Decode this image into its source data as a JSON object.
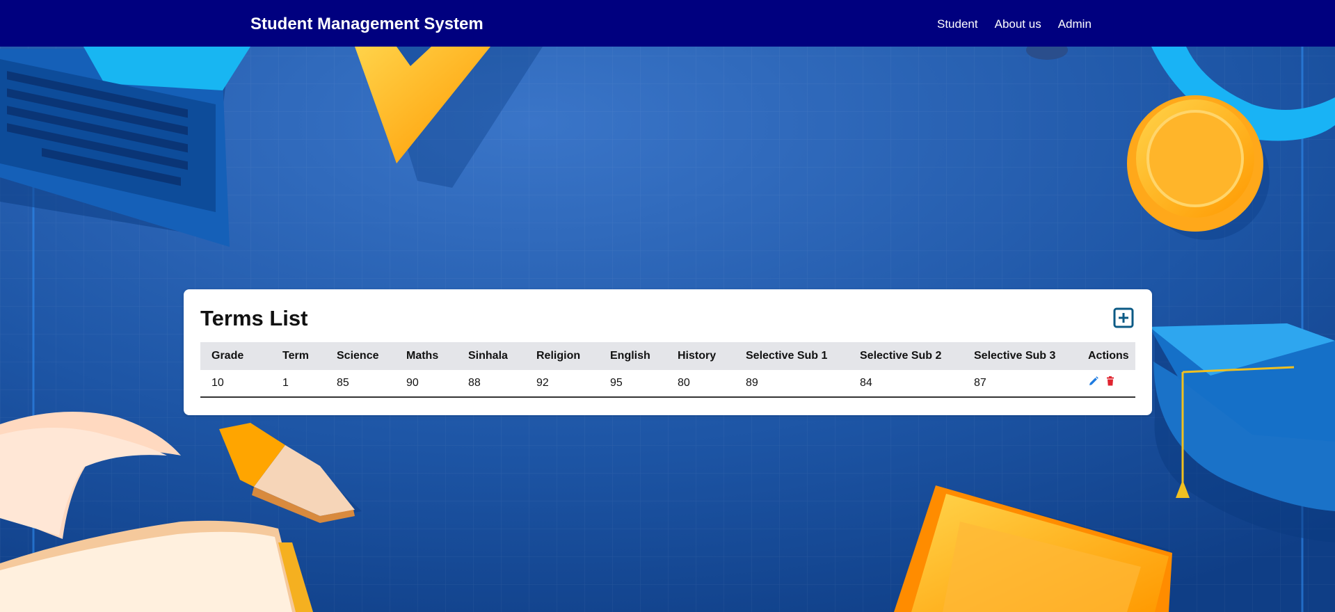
{
  "navbar": {
    "brand": "Student Management System",
    "links": [
      {
        "label": "Student"
      },
      {
        "label": "About us"
      },
      {
        "label": "Admin"
      }
    ]
  },
  "card": {
    "title": "Terms List",
    "add_icon": "plus-square-icon"
  },
  "table": {
    "headers": [
      "Grade",
      "Term",
      "Science",
      "Maths",
      "Sinhala",
      "Religion",
      "English",
      "History",
      "Selective Sub 1",
      "Selective Sub 2",
      "Selective Sub 3",
      "Actions"
    ],
    "rows": [
      [
        "10",
        "1",
        "85",
        "90",
        "88",
        "92",
        "95",
        "80",
        "89",
        "84",
        "87"
      ]
    ],
    "action_icons": [
      "pencil-icon",
      "trash-icon"
    ]
  },
  "colors": {
    "navbar": "#00007f",
    "background": "#1e56a8",
    "edit": "#1e7be0",
    "delete": "#e0242f",
    "add": "#0b5a85"
  }
}
